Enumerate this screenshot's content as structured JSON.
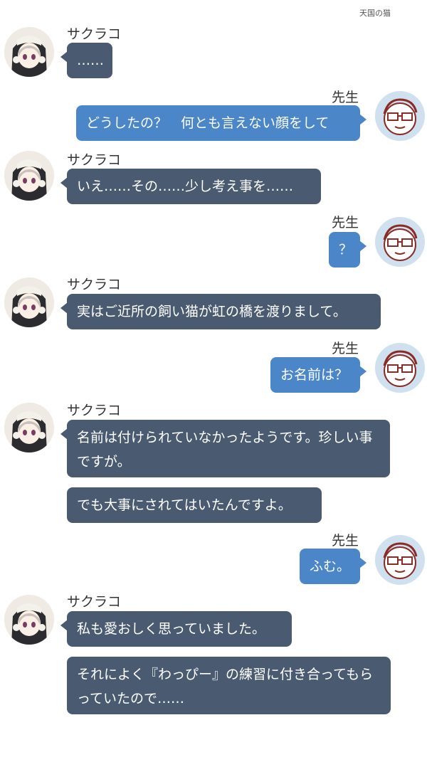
{
  "header": {
    "title": "天国の猫"
  },
  "characters": {
    "sakurako": {
      "name": "サクラコ"
    },
    "sensei": {
      "name": "先生"
    }
  },
  "messages": [
    {
      "speaker": "sakurako",
      "text": "……"
    },
    {
      "speaker": "sensei",
      "text": "どうしたの？　何とも言えない顔をして"
    },
    {
      "speaker": "sakurako",
      "text": "いえ……その……少し考え事を……"
    },
    {
      "speaker": "sensei",
      "text": "？"
    },
    {
      "speaker": "sakurako",
      "text": "実はご近所の飼い猫が虹の橋を渡りまして。"
    },
    {
      "speaker": "sensei",
      "text": "お名前は？"
    },
    {
      "speaker": "sakurako",
      "text": "名前は付けられていなかったようです。珍しい事ですが。"
    },
    {
      "speaker": "sakurako",
      "text": "でも大事にされてはいたんですよ。"
    },
    {
      "speaker": "sensei",
      "text": "ふむ。"
    },
    {
      "speaker": "sakurako",
      "text": "私も愛おしく思っていました。"
    },
    {
      "speaker": "sakurako",
      "text": "それによく『わっぴー』の練習に付き合ってもらっていたので……"
    }
  ]
}
